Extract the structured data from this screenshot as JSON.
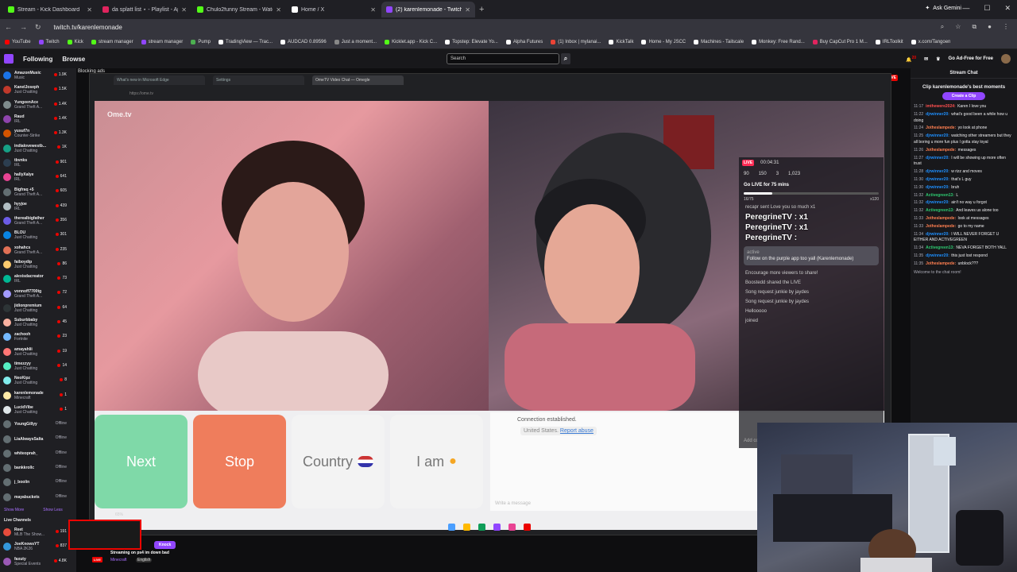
{
  "browser": {
    "tabs": [
      {
        "title": "Stream - Kick Dashboard",
        "color": "#53fc18",
        "active": false
      },
      {
        "title": "da splatt list ⋆ - Playlist - App",
        "color": "#e0245e",
        "active": false
      },
      {
        "title": "Chulo2funny Stream - Watch L",
        "color": "#53fc18",
        "active": false
      },
      {
        "title": "Home / X",
        "color": "#ffffff",
        "active": false
      },
      {
        "title": "(2) karenlemonade - Twitch",
        "color": "#9146ff",
        "active": true
      }
    ],
    "ask_gemini": "Ask Gemini",
    "url": "twitch.tv/karenlemonade",
    "bookmarks": [
      {
        "label": "YouTube",
        "color": "#ff0000"
      },
      {
        "label": "Twitch",
        "color": "#9146ff"
      },
      {
        "label": "Kick",
        "color": "#53fc18"
      },
      {
        "label": "stream manager",
        "color": "#53fc18"
      },
      {
        "label": "stream manager",
        "color": "#9146ff"
      },
      {
        "label": "Pump",
        "color": "#4caf50"
      },
      {
        "label": "TradingView — Trac...",
        "color": "#ffffff"
      },
      {
        "label": "AUDCAD 0.89596",
        "color": "#ffffff"
      },
      {
        "label": "Just a moment...",
        "color": "#888888"
      },
      {
        "label": "Kicklet.app - Kick C...",
        "color": "#53fc18"
      },
      {
        "label": "Topstep: Elevate Yo...",
        "color": "#ffffff"
      },
      {
        "label": "Alpha Futures",
        "color": "#ffffff"
      },
      {
        "label": "(1) Inbox | mylanai...",
        "color": "#ea4335"
      },
      {
        "label": "KickTalk",
        "color": "#ffffff"
      },
      {
        "label": "Home - My JSCC",
        "color": "#ffffff"
      },
      {
        "label": "Machines - Tailscale",
        "color": "#ffffff"
      },
      {
        "label": "Monkey: Free Rand...",
        "color": "#ffffff"
      },
      {
        "label": "Buy CapCut Pro 1 M...",
        "color": "#e0245e"
      },
      {
        "label": "IRLToolkit",
        "color": "#ffffff"
      },
      {
        "label": "x.com/Tangoen",
        "color": "#ffffff"
      }
    ]
  },
  "twitch": {
    "following": "Following",
    "browse": "Browse",
    "search_placeholder": "Search",
    "notif_count": "20",
    "ad_free": "Go Ad-Free for Free"
  },
  "sidebar": {
    "channels": [
      {
        "name": "AmazonMusic",
        "game": "Music",
        "viewers": "1.9K",
        "live": true,
        "color": "#1a73e8"
      },
      {
        "name": "KaneIJoseph",
        "game": "Just Chatting",
        "viewers": "1.5K",
        "live": true,
        "color": "#c0392b"
      },
      {
        "name": "YungeenAce",
        "game": "Grand Theft A...",
        "viewers": "1.4K",
        "live": true,
        "color": "#7f8c8d"
      },
      {
        "name": "Raud",
        "game": "IRL",
        "viewers": "1.4K",
        "live": true,
        "color": "#8e44ad"
      },
      {
        "name": "yusuf7n",
        "game": "Counter-Strike",
        "viewers": "1.3K",
        "live": true,
        "color": "#d35400"
      },
      {
        "name": "indialovewestb...",
        "game": "Just Chatting",
        "viewers": "1K",
        "live": true,
        "color": "#16a085"
      },
      {
        "name": "tbvnks",
        "game": "IRL",
        "viewers": "901",
        "live": true,
        "color": "#2c3e50"
      },
      {
        "name": "hallyXalye",
        "game": "IRL",
        "viewers": "641",
        "live": true,
        "color": "#e84393"
      },
      {
        "name": "Bigfraq +5",
        "game": "Grand Theft A...",
        "viewers": "605",
        "live": true,
        "color": "#636e72"
      },
      {
        "name": "hyyjoe",
        "game": "IRL",
        "viewers": "439",
        "live": true,
        "color": "#b2bec3"
      },
      {
        "name": "therealbigfather",
        "game": "Grand Theft A...",
        "viewers": "356",
        "live": true,
        "color": "#6c5ce7"
      },
      {
        "name": "BLOU",
        "game": "Just Chatting",
        "viewers": "301",
        "live": true,
        "color": "#0984e3"
      },
      {
        "name": "xohahcs",
        "game": "Grand Theft A...",
        "viewers": "235",
        "live": true,
        "color": "#e17055"
      },
      {
        "name": "faiboydip",
        "game": "Just Chatting",
        "viewers": "86",
        "live": true,
        "color": "#fdcb6e"
      },
      {
        "name": "alexisdacreator",
        "game": "IRL",
        "viewers": "73",
        "live": true,
        "color": "#00b894"
      },
      {
        "name": "vonnoff7700tg",
        "game": "Grand Theft A...",
        "viewers": "72",
        "live": true,
        "color": "#a29bfe"
      },
      {
        "name": "jidionpremium",
        "game": "Just Chatting",
        "viewers": "64",
        "live": true,
        "color": "#2d3436"
      },
      {
        "name": "Suburbbaby",
        "game": "Just Chatting",
        "viewers": "45",
        "live": true,
        "color": "#fab1a0"
      },
      {
        "name": "zachooh",
        "game": "Fortnite",
        "viewers": "23",
        "live": true,
        "color": "#74b9ff"
      },
      {
        "name": "amayahlii",
        "game": "Just Chatting",
        "viewers": "19",
        "live": true,
        "color": "#ff7675"
      },
      {
        "name": "timezzyy",
        "game": "Just Chatting",
        "viewers": "14",
        "live": true,
        "color": "#55efc4"
      },
      {
        "name": "NeoKipz",
        "game": "Just Chatting",
        "viewers": "8",
        "live": true,
        "color": "#81ecec"
      },
      {
        "name": "karenlemonade",
        "game": "Minecraft",
        "viewers": "1",
        "live": true,
        "color": "#ffeaa7"
      },
      {
        "name": "LucidVibe",
        "game": "Just Chatting",
        "viewers": "1",
        "live": true,
        "color": "#dfe6e9"
      },
      {
        "name": "YoungGillyy",
        "game": "",
        "viewers": "Offline",
        "live": false,
        "color": "#636e72"
      },
      {
        "name": "LiaAlwaysSalta",
        "game": "",
        "viewers": "Offline",
        "live": false,
        "color": "#636e72"
      },
      {
        "name": "whiteoprah_",
        "game": "",
        "viewers": "Offline",
        "live": false,
        "color": "#636e72"
      },
      {
        "name": "bankkrollc",
        "game": "",
        "viewers": "Offline",
        "live": false,
        "color": "#636e72"
      },
      {
        "name": "j_boolin",
        "game": "",
        "viewers": "Offline",
        "live": false,
        "color": "#636e72"
      },
      {
        "name": "mayabuckets",
        "game": "",
        "viewers": "Offline",
        "live": false,
        "color": "#636e72"
      }
    ],
    "show_more": "Show More",
    "show_less": "Show Less",
    "live_channels": "Live Channels",
    "live_list": [
      {
        "name": "Reet",
        "game": "MLB The Show...",
        "viewers": "191",
        "color": "#e74c3c"
      },
      {
        "name": "JoeKnowsYT",
        "game": "NBA 2K26",
        "viewers": "837",
        "color": "#3498db"
      },
      {
        "name": "faxuty",
        "game": "Special Events",
        "viewers": "4.8K",
        "color": "#9b59b6"
      }
    ]
  },
  "main": {
    "blocking_ads": "Blocking ads",
    "live_label": "LIVE",
    "inner_tabs": [
      "What's new in Microsoft Edge",
      "Settings",
      "OmeTV Video Chat — Omegle"
    ],
    "inner_url": "https://ome.tv",
    "ome_logo": "Ome.tv",
    "buttons": {
      "next": "Next",
      "stop": "Stop",
      "country": "Country",
      "iam": "I am"
    },
    "connection": "Connection established.",
    "location": "United States.",
    "report": "Report abuse",
    "write_placeholder": "Write a message",
    "zoom": "65%",
    "tiktok": {
      "live": "LIVE",
      "time": "00:04:31",
      "stats": [
        "90",
        "150",
        "3",
        "1,023"
      ],
      "goal": "Go LIVE for 75 mins",
      "goal_progress": 0.21,
      "goal_count": "16/75",
      "goal_reward": "x120",
      "lines": [
        "recapr sent Love you so much  x1",
        "PeregrineTV : x1",
        "PeregrineTV : x1",
        "PeregrineTV :"
      ],
      "pinned": "Follow on the purple app too yall (Karenlemonade)",
      "pinned_user": "active",
      "events": [
        "Encourage more viewers to share!",
        "Boostedd  shared the LIVE",
        "Song request junkie by jaydes",
        "Song request junkie by jaydes",
        "Hellooooo",
        "joined"
      ],
      "add_comment": "Add comment..."
    }
  },
  "streaminfo": {
    "knock": "Knock",
    "title": "Streaming on ps4 im down bad",
    "live": "LIVE",
    "category": "Minecraft",
    "language": "English"
  },
  "chat": {
    "header": "Stream Chat",
    "best_moments": "Clip karenlemonade's best moments",
    "create_clip": "Create a Clip",
    "messages": [
      {
        "t": "11:17",
        "u": "imthewere2024:",
        "c": "#ff4f4f",
        "m": "Karen I love you"
      },
      {
        "t": "11:22",
        "u": "djrwinner20:",
        "c": "#1e90ff",
        "m": "what's good been a while how u doing"
      },
      {
        "t": "11:24",
        "u": "Jotheslampede:",
        "c": "#ff7f50",
        "m": "yo look at phone"
      },
      {
        "t": "11:25",
        "u": "djrwinner20:",
        "c": "#1e90ff",
        "m": "watching other streamers but they all boring u more fun plus I gotta stay loyal"
      },
      {
        "t": "11:26",
        "u": "Jotheslampede:",
        "c": "#ff7f50",
        "m": "messages"
      },
      {
        "t": "11:27",
        "u": "djrwinner20:",
        "c": "#1e90ff",
        "m": "I will be showing up more often trust"
      },
      {
        "t": "11:28",
        "u": "djrwinner20:",
        "c": "#1e90ff",
        "m": "w rizz and moves"
      },
      {
        "t": "11:30",
        "u": "djrwinner20:",
        "c": "#1e90ff",
        "m": "that's L guy"
      },
      {
        "t": "11:30",
        "u": "djrwinner20:",
        "c": "#1e90ff",
        "m": "bruh"
      },
      {
        "t": "11:32",
        "u": "Activegreen13:",
        "c": "#2ecc71",
        "m": "L"
      },
      {
        "t": "11:32",
        "u": "djrwinner20:",
        "c": "#1e90ff",
        "m": "ain't no way u forgot"
      },
      {
        "t": "11:32",
        "u": "Activegreen13:",
        "c": "#2ecc71",
        "m": "And leaves us alone too"
      },
      {
        "t": "11:33",
        "u": "Jotheslampede:",
        "c": "#ff7f50",
        "m": "look at messages"
      },
      {
        "t": "11:33",
        "u": "Jotheslampede:",
        "c": "#ff7f50",
        "m": "go to my name"
      },
      {
        "t": "11:34",
        "u": "djrwinner20:",
        "c": "#1e90ff",
        "m": "I WILL NEVER FORGET U EITHER AND ACTIVEGREEN"
      },
      {
        "t": "11:34",
        "u": "Activegreen13:",
        "c": "#2ecc71",
        "m": "NEVA FORGET BOTH YALL"
      },
      {
        "t": "11:35",
        "u": "djrwinner20:",
        "c": "#1e90ff",
        "m": "this just lost respond"
      },
      {
        "t": "11:35",
        "u": "Jotheslampede:",
        "c": "#ff7f50",
        "m": "unblock???"
      }
    ],
    "welcome": "Welcome to the chat room!"
  }
}
